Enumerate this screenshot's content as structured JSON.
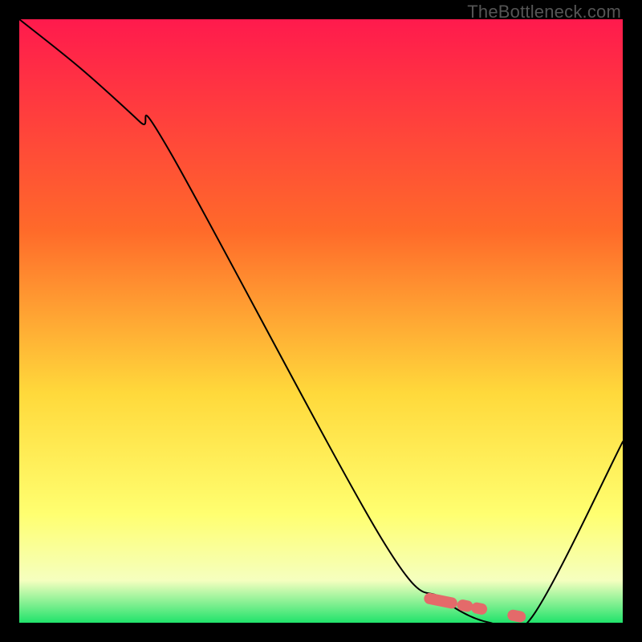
{
  "watermark": "TheBottleneck.com",
  "colors": {
    "gradient_top": "#ff1a4d",
    "gradient_mid1": "#ff6a2a",
    "gradient_mid2": "#ffd93b",
    "gradient_mid3": "#ffff70",
    "gradient_mid4": "#f5ffbf",
    "gradient_bottom": "#21e36b",
    "curve": "#000000",
    "marker": "#e46a6a"
  },
  "chart_data": {
    "type": "line",
    "title": "",
    "xlabel": "",
    "ylabel": "",
    "xlim": [
      0,
      100
    ],
    "ylim": [
      0,
      100
    ],
    "grid": false,
    "legend": false,
    "series": [
      {
        "name": "bottleneck-curve",
        "x": [
          0,
          10,
          20,
          25,
          60,
          70,
          78,
          85,
          100
        ],
        "y": [
          100,
          92,
          83,
          78,
          14,
          4,
          0,
          1,
          30
        ]
      }
    ],
    "annotations": [
      {
        "name": "optimal-range-marker",
        "type": "segment",
        "x": [
          68,
          83
        ],
        "y": [
          4,
          1
        ]
      }
    ]
  }
}
